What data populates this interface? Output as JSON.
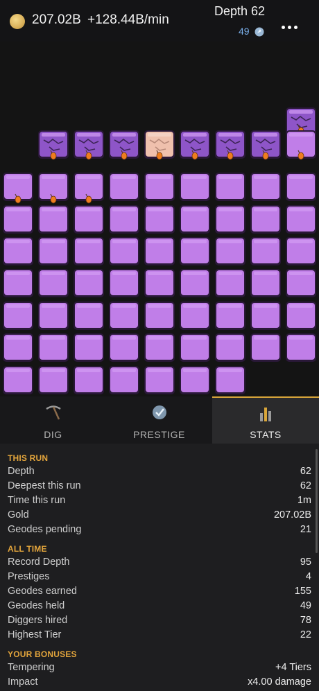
{
  "header": {
    "gold": "207.02B",
    "gold_rate": "+128.44B/min",
    "depth_label": "Depth 62",
    "geodes": "49",
    "coin_icon": "coin-icon",
    "geode_icon": "geode-icon",
    "menu_icon": "more-icon"
  },
  "board": {
    "colors": {
      "block": "#c07ee8",
      "block_top": "#d39cf3",
      "block_dark": "#8a4bb8",
      "outline": "#2a1838",
      "cracked": "#8e55c8",
      "active": "#efc0ad",
      "marker": "#ee7d1f",
      "background": "#141414"
    }
  },
  "tabs": [
    {
      "label": "DIG",
      "icon": "pickaxe-icon"
    },
    {
      "label": "PRESTIGE",
      "icon": "prestige-icon"
    },
    {
      "label": "STATS",
      "icon": "stats-icon"
    }
  ],
  "stats": {
    "this_run": {
      "title": "THIS RUN",
      "rows": [
        {
          "label": "Depth",
          "value": "62"
        },
        {
          "label": "Deepest this run",
          "value": "62"
        },
        {
          "label": "Time this run",
          "value": "1m"
        },
        {
          "label": "Gold",
          "value": "207.02B"
        },
        {
          "label": "Geodes pending",
          "value": "21"
        }
      ]
    },
    "all_time": {
      "title": "ALL TIME",
      "rows": [
        {
          "label": "Record Depth",
          "value": "95"
        },
        {
          "label": "Prestiges",
          "value": "4"
        },
        {
          "label": "Geodes earned",
          "value": "155"
        },
        {
          "label": "Geodes held",
          "value": "49"
        },
        {
          "label": "Diggers hired",
          "value": "78"
        },
        {
          "label": "Highest Tier",
          "value": "22"
        }
      ]
    },
    "bonuses": {
      "title": "YOUR BONUSES",
      "rows": [
        {
          "label": "Tempering",
          "value": "+4 Tiers"
        },
        {
          "label": "Impact",
          "value": "x4.00 damage"
        }
      ]
    }
  }
}
